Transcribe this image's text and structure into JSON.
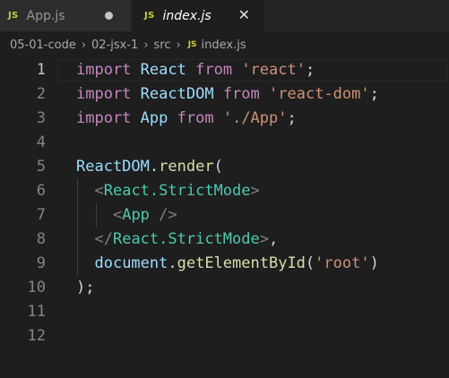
{
  "tabs": [
    {
      "icon": "JS",
      "label": "App.js",
      "state": "unsaved"
    },
    {
      "icon": "JS",
      "label": "index.js",
      "state": "active"
    }
  ],
  "breadcrumb": {
    "folders": [
      "05-01-code",
      "02-jsx-1",
      "src"
    ],
    "file_icon": "JS",
    "file": "index.js"
  },
  "editor": {
    "line_numbers": [
      "1",
      "2",
      "3",
      "4",
      "5",
      "6",
      "7",
      "8",
      "9",
      "10",
      "11",
      "12"
    ],
    "active_line": "1",
    "lines": [
      [
        {
          "t": "import",
          "c": "kw"
        },
        {
          "t": " ",
          "c": "pun"
        },
        {
          "t": "React",
          "c": "var"
        },
        {
          "t": " ",
          "c": "pun"
        },
        {
          "t": "from",
          "c": "kw"
        },
        {
          "t": " ",
          "c": "pun"
        },
        {
          "t": "'react'",
          "c": "str"
        },
        {
          "t": ";",
          "c": "pun"
        }
      ],
      [
        {
          "t": "import",
          "c": "kw"
        },
        {
          "t": " ",
          "c": "pun"
        },
        {
          "t": "ReactDOM",
          "c": "var"
        },
        {
          "t": " ",
          "c": "pun"
        },
        {
          "t": "from",
          "c": "kw"
        },
        {
          "t": " ",
          "c": "pun"
        },
        {
          "t": "'react-dom'",
          "c": "str"
        },
        {
          "t": ";",
          "c": "pun"
        }
      ],
      [
        {
          "t": "import",
          "c": "kw"
        },
        {
          "t": " ",
          "c": "pun"
        },
        {
          "t": "App",
          "c": "var"
        },
        {
          "t": " ",
          "c": "pun"
        },
        {
          "t": "from",
          "c": "kw"
        },
        {
          "t": " ",
          "c": "pun"
        },
        {
          "t": "'./App'",
          "c": "str"
        },
        {
          "t": ";",
          "c": "pun"
        }
      ],
      [],
      [
        {
          "t": "ReactDOM",
          "c": "var"
        },
        {
          "t": ".",
          "c": "pun"
        },
        {
          "t": "render",
          "c": "fn"
        },
        {
          "t": "(",
          "c": "pun"
        }
      ],
      [
        {
          "t": "  ",
          "c": "pun"
        },
        {
          "t": "<",
          "c": "tagp"
        },
        {
          "t": "React.StrictMode",
          "c": "cls"
        },
        {
          "t": ">",
          "c": "tagp"
        }
      ],
      [
        {
          "t": "    ",
          "c": "pun"
        },
        {
          "t": "<",
          "c": "tagp"
        },
        {
          "t": "App",
          "c": "cls"
        },
        {
          "t": " />",
          "c": "tagp"
        }
      ],
      [
        {
          "t": "  ",
          "c": "pun"
        },
        {
          "t": "</",
          "c": "tagp"
        },
        {
          "t": "React.StrictMode",
          "c": "cls"
        },
        {
          "t": ">",
          "c": "tagp"
        },
        {
          "t": ",",
          "c": "pun"
        }
      ],
      [
        {
          "t": "  ",
          "c": "pun"
        },
        {
          "t": "document",
          "c": "var"
        },
        {
          "t": ".",
          "c": "pun"
        },
        {
          "t": "getElementById",
          "c": "fn"
        },
        {
          "t": "(",
          "c": "pun"
        },
        {
          "t": "'root'",
          "c": "str"
        },
        {
          "t": ")",
          "c": "pun"
        }
      ],
      [
        {
          "t": ")",
          "c": "pun"
        },
        {
          "t": ";",
          "c": "pun"
        }
      ],
      [],
      []
    ]
  },
  "colors": {
    "keyword": "#c586c0",
    "variable": "#9cdcfe",
    "string": "#ce9178",
    "component": "#4ec9b0",
    "function": "#dcdcaa",
    "js_icon": "#cbcb41"
  }
}
